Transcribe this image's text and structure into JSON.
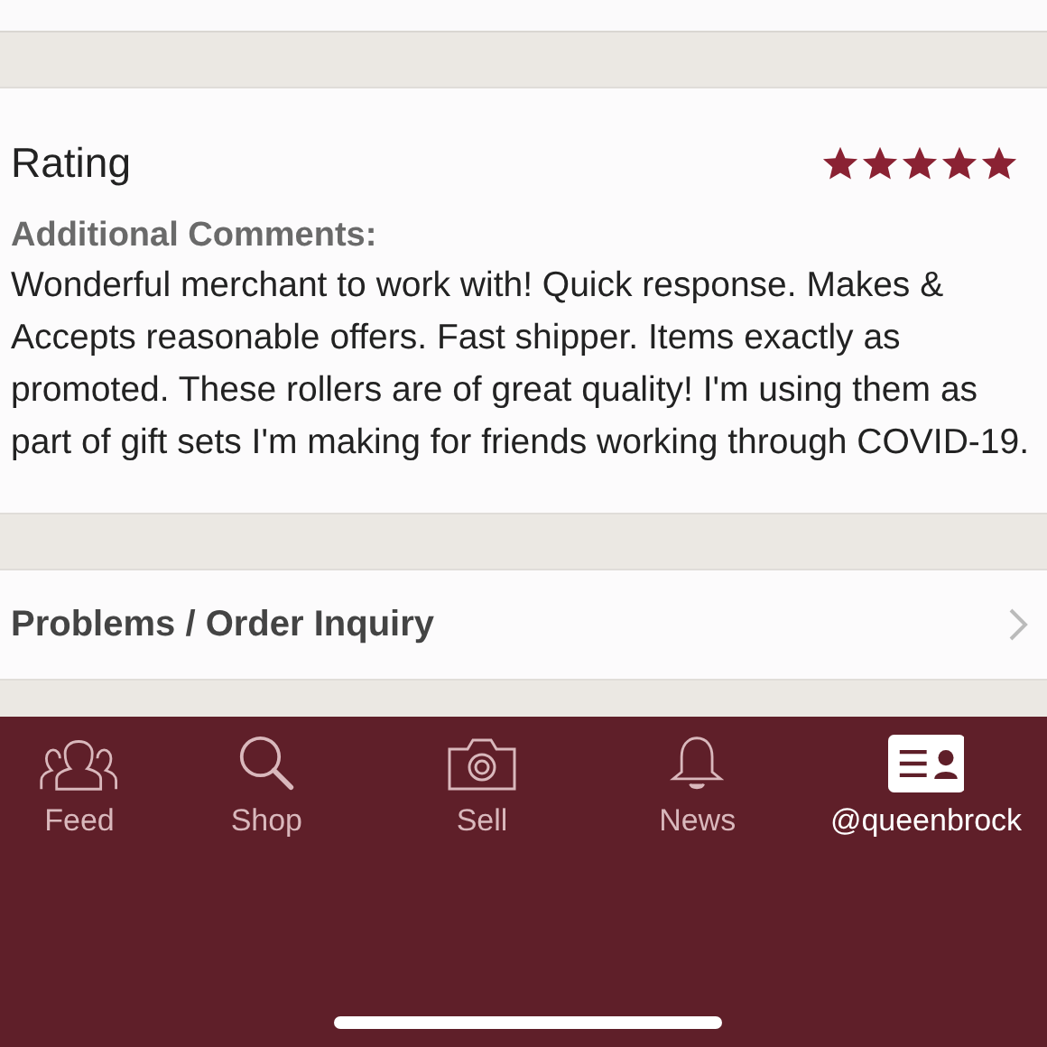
{
  "rating": {
    "label": "Rating",
    "stars": 5
  },
  "comments": {
    "heading": "Additional Comments:",
    "text": "Wonderful merchant to work with! Quick response. Makes & Accepts reasonable offers. Fast shipper. Items exactly as promoted. These rollers are of great quality! I'm using them as part of gift sets I'm making for friends working through COVID-19."
  },
  "problems": {
    "label": "Problems / Order Inquiry"
  },
  "tab_bar": [
    {
      "kind": "feed",
      "label": "Feed",
      "selected": false
    },
    {
      "kind": "shop",
      "label": "Shop",
      "selected": false
    },
    {
      "kind": "sell",
      "label": "Sell",
      "selected": false
    },
    {
      "kind": "news",
      "label": "News",
      "selected": false
    },
    {
      "kind": "profile",
      "label": "@queenbrock",
      "selected": true
    }
  ]
}
